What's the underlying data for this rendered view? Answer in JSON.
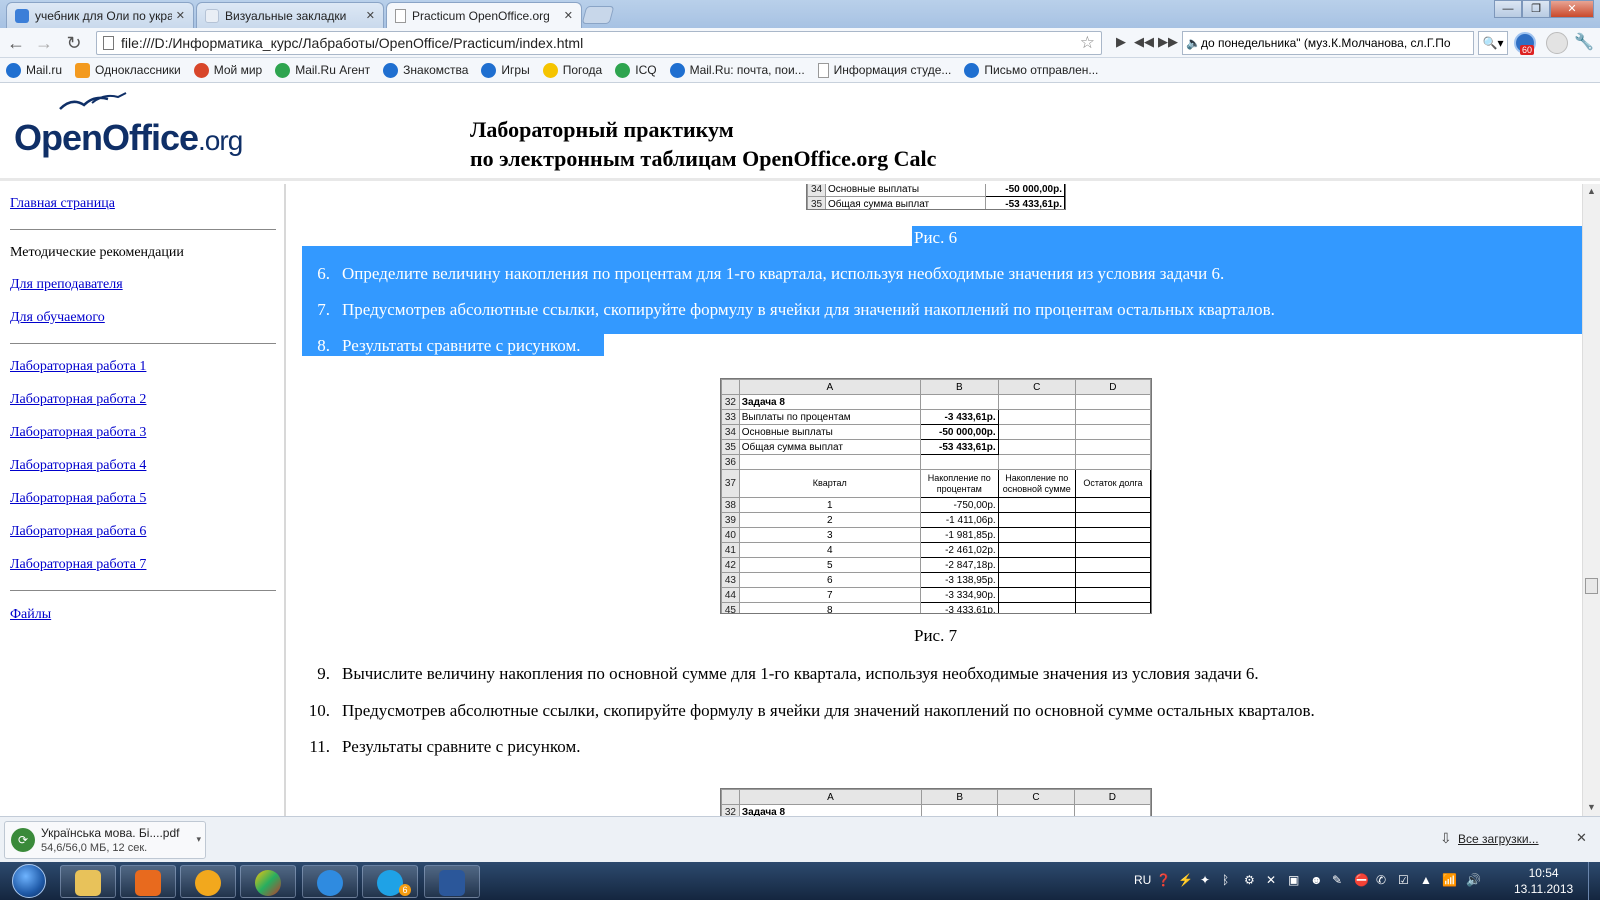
{
  "browser": {
    "tabs": [
      {
        "label": "учебник для Оли по укра",
        "color": "#3b7ed8"
      },
      {
        "label": "Визуальные закладки",
        "color": "#e9eef5"
      },
      {
        "label": "Practicum OpenOffice.org",
        "color": "#ffffff"
      }
    ],
    "url": "file:///D:/Информатика_курс/Лабработы/OpenOffice/Practicum/index.html",
    "player_title": "до понедельника\" (муз.К.Молчанова, сл.Г.По",
    "ext_badge": "60",
    "bookmarks": [
      {
        "label": "Mail.ru",
        "icon": "mailru-icon",
        "color": "#1f6fd0"
      },
      {
        "label": "Одноклассники",
        "icon": "odnoklassniki-icon",
        "color": "#f39a1f"
      },
      {
        "label": "Мой мир",
        "icon": "moymir-icon",
        "color": "#d8462a"
      },
      {
        "label": "Mail.Ru Агент",
        "icon": "agent-icon",
        "color": "#2ea44f"
      },
      {
        "label": "Знакомства",
        "icon": "at-icon",
        "color": "#1f6fd0"
      },
      {
        "label": "Игры",
        "icon": "games-icon",
        "color": "#1f6fd0"
      },
      {
        "label": "Погода",
        "icon": "weather-icon",
        "color": "#f5c400"
      },
      {
        "label": "ICQ",
        "icon": "icq-icon",
        "color": "#2ea44f"
      },
      {
        "label": "Mail.Ru: почта, пои...",
        "icon": "mailru-icon",
        "color": "#1f6fd0"
      },
      {
        "label": "Информация студе...",
        "icon": "page-icon",
        "color": "#ffffff"
      },
      {
        "label": "Письмо отправлен...",
        "icon": "mailru-icon",
        "color": "#1f6fd0"
      }
    ]
  },
  "header": {
    "logo_main": "OpenOffice",
    "logo_suffix": ".org",
    "title_line1": "Лабораторный практикум",
    "title_line2": "по электронным таблицам OpenOffice.org Calc"
  },
  "sidebar": {
    "home": "Главная страница",
    "section_label": "Методические рекомендации",
    "for_teacher": "Для преподавателя",
    "for_student": "Для обучаемого",
    "labs": [
      "Лабораторная работа 1",
      "Лабораторная работа 2",
      "Лабораторная работа 3",
      "Лабораторная работа 4",
      "Лабораторная работа 5",
      "Лабораторная работа 6",
      "Лабораторная работа 7"
    ],
    "files": "Файлы"
  },
  "content": {
    "top_sheet_rows": [
      {
        "row": "34",
        "label": "Основные выплаты",
        "value": "-50 000,00р."
      },
      {
        "row": "35",
        "label": "Общая сумма выплат",
        "value": "-53 433,61р."
      }
    ],
    "fig6": "Рис. 6",
    "steps_a": [
      {
        "num": "6.",
        "text": "Определите величину накопления по процентам для 1-го квартала, используя необходимые значения из условия задачи 6."
      },
      {
        "num": "7.",
        "text": "Предусмотрев абсолютные ссылки, скопируйте формулу в ячейки для значений накоплений по процентам остальных кварталов."
      },
      {
        "num": "8.",
        "text": "Результаты сравните с рисунком."
      }
    ],
    "fig7_sheet": {
      "cols": [
        "A",
        "B",
        "C",
        "D"
      ],
      "rows": [
        {
          "row": "32",
          "a": "Задача 8",
          "b": "",
          "c": "",
          "d": ""
        },
        {
          "row": "33",
          "a": "Выплаты по процентам",
          "b": "-3 433,61р.",
          "c": "",
          "d": ""
        },
        {
          "row": "34",
          "a": "Основные выплаты",
          "b": "-50 000,00р.",
          "c": "",
          "d": ""
        },
        {
          "row": "35",
          "a": "Общая сумма выплат",
          "b": "-53 433,61р.",
          "c": "",
          "d": ""
        },
        {
          "row": "36",
          "a": "",
          "b": "",
          "c": "",
          "d": ""
        },
        {
          "row": "37",
          "a": "Квартал",
          "b": "Накопление по процентам",
          "c": "Накопление по основной сумме",
          "d": "Остаток долга"
        },
        {
          "row": "38",
          "a": "1",
          "b": "-750,00р.",
          "c": "",
          "d": ""
        },
        {
          "row": "39",
          "a": "2",
          "b": "-1 411,06р.",
          "c": "",
          "d": ""
        },
        {
          "row": "40",
          "a": "3",
          "b": "-1 981,85р.",
          "c": "",
          "d": ""
        },
        {
          "row": "41",
          "a": "4",
          "b": "-2 461,02р.",
          "c": "",
          "d": ""
        },
        {
          "row": "42",
          "a": "5",
          "b": "-2 847,18р.",
          "c": "",
          "d": ""
        },
        {
          "row": "43",
          "a": "6",
          "b": "-3 138,95р.",
          "c": "",
          "d": ""
        },
        {
          "row": "44",
          "a": "7",
          "b": "-3 334,90р.",
          "c": "",
          "d": ""
        },
        {
          "row": "45",
          "a": "8",
          "b": "-3 433,61р.",
          "c": "",
          "d": ""
        }
      ]
    },
    "fig7": "Рис. 7",
    "steps_b": [
      {
        "num": "9.",
        "text": "Вычислите величину накопления по основной сумме для 1-го квартала, используя необходимые значения из условия задачи 6."
      },
      {
        "num": "10.",
        "text": "Предусмотрев абсолютные ссылки, скопируйте формулу в ячейки для значений накоплений по основной сумме остальных кварталов."
      },
      {
        "num": "11.",
        "text": "Результаты сравните с рисунком."
      }
    ],
    "bottom_sheet": {
      "cols": [
        "A",
        "B",
        "C",
        "D"
      ],
      "row": "32",
      "a": "Задача 8"
    }
  },
  "downloads": {
    "file_name": "Українська мова. Бі....pdf",
    "status": "54,6/56,0 МБ, 12 сек.",
    "all_label": "Все загрузки..."
  },
  "taskbar": {
    "lang": "RU",
    "time": "10:54",
    "date": "13.11.2013",
    "skype_badge": "6"
  },
  "colors": {
    "selection": "#3399ff",
    "link": "#0000cc",
    "logo": "#0f2f67"
  }
}
